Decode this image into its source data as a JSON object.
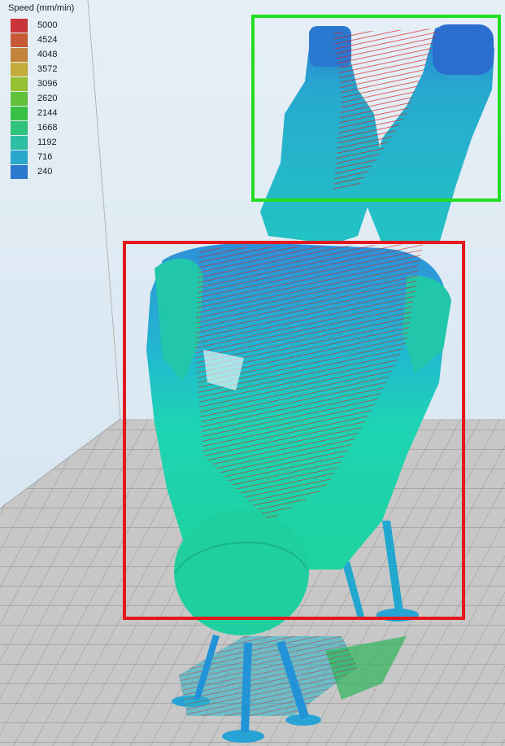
{
  "legend": {
    "title": "Speed (mm/min)",
    "items": [
      {
        "label": "5000",
        "color": "#c8343a"
      },
      {
        "label": "4524",
        "color": "#c65a36"
      },
      {
        "label": "4048",
        "color": "#c4833a"
      },
      {
        "label": "3572",
        "color": "#c3ac3a"
      },
      {
        "label": "3096",
        "color": "#96c034"
      },
      {
        "label": "2620",
        "color": "#62c23c"
      },
      {
        "label": "2144",
        "color": "#38c044"
      },
      {
        "label": "1668",
        "color": "#2ec27a"
      },
      {
        "label": "1192",
        "color": "#2cbfa4"
      },
      {
        "label": "716",
        "color": "#29a6cb"
      },
      {
        "label": "240",
        "color": "#2a79cc"
      }
    ]
  },
  "highlights": [
    {
      "name": "green-highlight-box",
      "color": "#22dd22"
    },
    {
      "name": "red-highlight-box",
      "color": "#e5161c"
    }
  ]
}
